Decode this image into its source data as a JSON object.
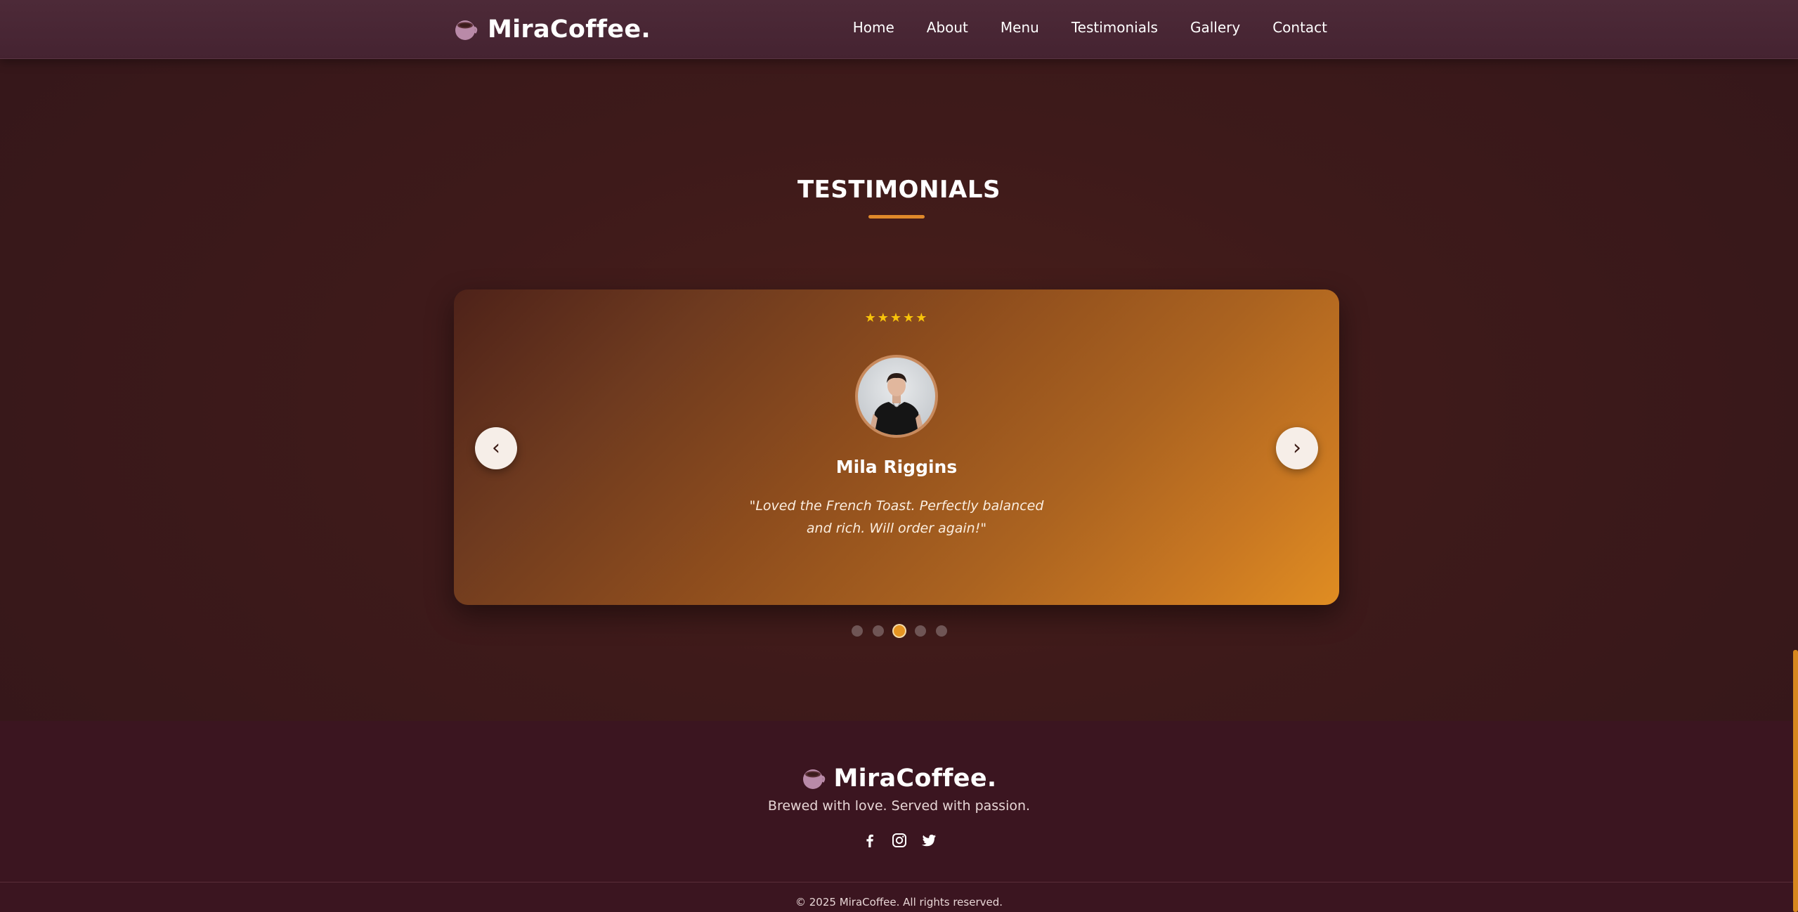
{
  "nav": {
    "brand": "MiraCoffee.",
    "links": [
      "Home",
      "About",
      "Menu",
      "Testimonials",
      "Gallery",
      "Contact"
    ]
  },
  "section": {
    "title": "TESTIMONIALS",
    "accent_color": "#e0892a"
  },
  "testimonial": {
    "rating_stars": "★★★★★",
    "rating_value": 5,
    "name": "Mila Riggins",
    "quote": "\"Loved the French Toast. Perfectly balanced and rich. Will order again!\"",
    "prev_label": "‹",
    "next_label": "›"
  },
  "carousel": {
    "slide_count": 5,
    "active_index": 2
  },
  "footer": {
    "brand": "MiraCoffee.",
    "tagline": "Brewed with love. Served with passion.",
    "social_icons": [
      "facebook-icon",
      "instagram-icon",
      "twitter-icon"
    ],
    "copyright": "© 2025 MiraCoffee. All rights reserved."
  },
  "colors": {
    "star": "#f7c30a",
    "active_dot": "#e59422",
    "scrollbar": "#d6871f"
  }
}
